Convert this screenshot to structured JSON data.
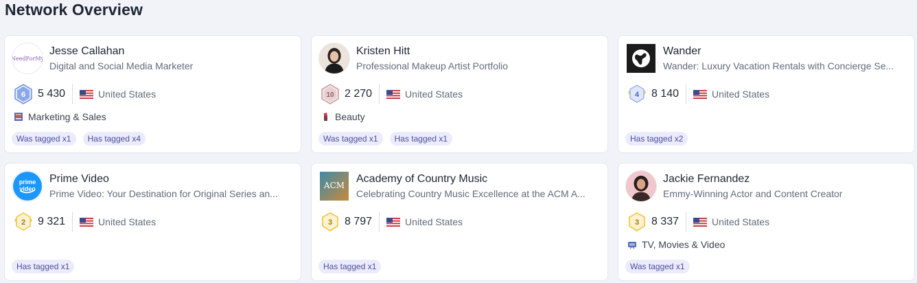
{
  "page": {
    "title": "Network Overview"
  },
  "cards": [
    {
      "name": "Jesse Callahan",
      "description": "Digital and Social Media Marketer",
      "avatar_text": "NeedForMy",
      "level": "6",
      "followers": "5 430",
      "country": "United States",
      "category": "Marketing & Sales",
      "tags": [
        "Was tagged x1",
        "Has tagged x4"
      ]
    },
    {
      "name": "Kristen Hitt",
      "description": "Professional Makeup Artist Portfolio",
      "level": "10",
      "followers": "2 270",
      "country": "United States",
      "category": "Beauty",
      "tags": [
        "Was tagged x1",
        "Has tagged x1"
      ]
    },
    {
      "name": "Wander",
      "description": "Wander: Luxury Vacation Rentals with Concierge Se...",
      "level": "4",
      "followers": "8 140",
      "country": "United States",
      "category": "",
      "tags": [
        "Has tagged x2"
      ]
    },
    {
      "name": "Prime Video",
      "description": "Prime Video: Your Destination for Original Series an...",
      "avatar_text": "prime video",
      "level": "2",
      "followers": "9 321",
      "country": "United States",
      "category": "",
      "tags": [
        "Has tagged x1"
      ]
    },
    {
      "name": "Academy of Country Music",
      "description": "Celebrating Country Music Excellence at the ACM A...",
      "avatar_text": "ACM",
      "level": "3",
      "followers": "8 797",
      "country": "United States",
      "category": "",
      "tags": [
        "Has tagged x1"
      ]
    },
    {
      "name": "Jackie Fernandez",
      "description": "Emmy-Winning Actor and Content Creator",
      "level": "3",
      "followers": "8 337",
      "country": "United States",
      "category": "TV, Movies & Video",
      "tags": [
        "Was tagged x1"
      ]
    }
  ],
  "colors": {
    "tag_bg": "#ecebfb",
    "tag_text": "#4a4f9c",
    "level_blue": "#6f8fe0",
    "level_rose": "#c89aa0",
    "level_gold": "#f2c94c"
  }
}
